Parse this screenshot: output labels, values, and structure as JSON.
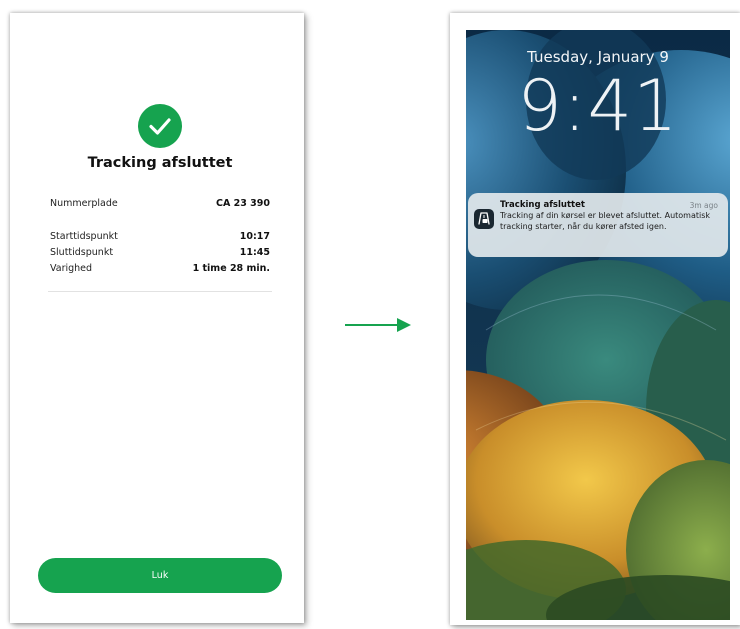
{
  "left_screen": {
    "title": "Tracking afsluttet",
    "details": [
      {
        "label": "Nummerplade",
        "value": "CA 23 390"
      },
      {
        "label": "Starttidspunkt",
        "value": "10:17"
      },
      {
        "label": "Sluttidspunkt",
        "value": "11:45"
      },
      {
        "label": "Varighed",
        "value": "1 time 28 min."
      }
    ],
    "close_label": "Luk"
  },
  "right_screen": {
    "date": "Tuesday, January 9",
    "time": "9:41",
    "notification": {
      "title": "Tracking afsluttet",
      "age": "3m ago",
      "body": "Tracking af din kørsel er blevet afsluttet. Automatisk tracking starter, når du kører afsted igen."
    }
  },
  "colors": {
    "accent": "#16a34f",
    "wallpaper_base": "#0e2f49",
    "notification_bg": "#e2e8ec"
  },
  "icons": {
    "success": "check-icon",
    "app": "app-icon",
    "transition": "arrow-right-icon"
  }
}
